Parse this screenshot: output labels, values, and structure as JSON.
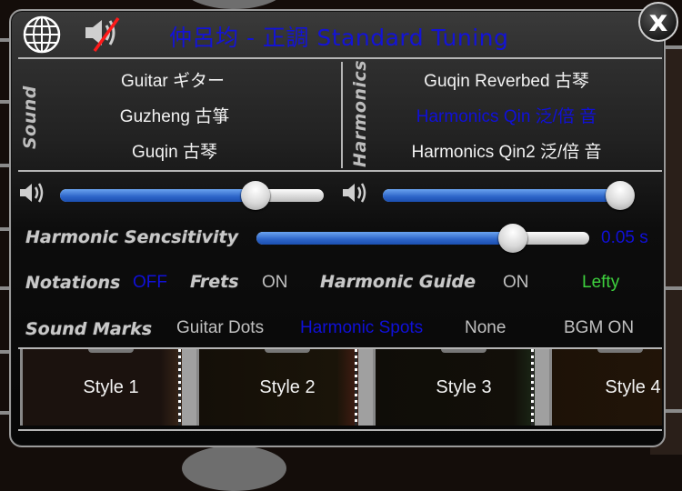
{
  "header": {
    "title": "仲呂均 - 正調 Standard Tuning",
    "language_icon": "globe-icon",
    "mute_icon": "speaker-muted-icon",
    "close_label": "x",
    "colors": {
      "title": "#1313d6",
      "mute_slash": "#ff1a1a"
    }
  },
  "sound": {
    "section_label": "Sound",
    "options": [
      {
        "label": "Guitar ギター",
        "selected": false
      },
      {
        "label": "Guzheng 古箏",
        "selected": false
      },
      {
        "label": "Guqin 古琴",
        "selected": false
      }
    ]
  },
  "harmonics": {
    "section_label": "Harmonics",
    "options": [
      {
        "label": "Guqin Reverbed 古琴",
        "selected": false
      },
      {
        "label": "Harmonics Qin 泛/倍 音",
        "selected": true
      },
      {
        "label": "Harmonics Qin2 泛/倍 音",
        "selected": false
      }
    ]
  },
  "volume": {
    "sound_volume": 0.74,
    "harmonics_volume": 1.0,
    "icon": "speaker-icon"
  },
  "sensitivity": {
    "label": "Harmonic Sencsitivity",
    "value_fraction": 0.77,
    "value_text": "0.05 s"
  },
  "settings": {
    "notations_label": "Notations",
    "notations_value": "OFF",
    "frets_label": "Frets",
    "frets_value": "ON",
    "harmonic_guide_label": "Harmonic Guide",
    "harmonic_guide_value": "ON",
    "lefty_label": "Lefty"
  },
  "sound_marks": {
    "label": "Sound Marks",
    "options": [
      "Guitar Dots",
      "Harmonic Spots",
      "None"
    ],
    "selected": "Harmonic Spots",
    "bgm_label": "BGM ON"
  },
  "styles": [
    {
      "label": "Style 1"
    },
    {
      "label": "Style 2"
    },
    {
      "label": "Style 3"
    },
    {
      "label": "Style 4"
    }
  ],
  "colors": {
    "selected_text": "#1010d8",
    "accent_green": "#3ed13e",
    "slider_fill": "#2c64c8"
  }
}
